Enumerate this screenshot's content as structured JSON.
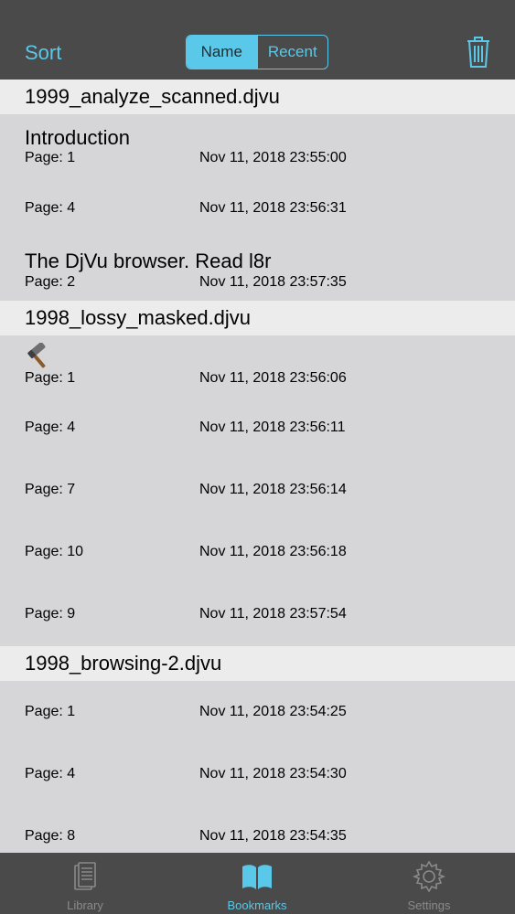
{
  "header": {
    "sort_label": "Sort",
    "segments": [
      {
        "label": "Name",
        "selected": true
      },
      {
        "label": "Recent",
        "selected": false
      }
    ],
    "trash_icon": "trash-icon"
  },
  "sections": [
    {
      "file": "1999_analyze_scanned.djvu",
      "items": [
        {
          "title": "Introduction",
          "page": "Page: 1",
          "date": "Nov 11, 2018 23:55:00"
        },
        {
          "title": "",
          "page": "Page: 4",
          "date": "Nov 11, 2018 23:56:31"
        },
        {
          "title": "The DjVu browser. Read l8r",
          "page": "Page: 2",
          "date": "Nov 11, 2018 23:57:35"
        }
      ]
    },
    {
      "file": "1998_lossy_masked.djvu",
      "items": [
        {
          "title_icon": "hammer-icon",
          "page": "Page: 1",
          "date": "Nov 11, 2018 23:56:06"
        },
        {
          "title": "",
          "page": "Page: 4",
          "date": "Nov 11, 2018 23:56:11"
        },
        {
          "title": "",
          "page": "Page: 7",
          "date": "Nov 11, 2018 23:56:14"
        },
        {
          "title": "",
          "page": "Page: 10",
          "date": "Nov 11, 2018 23:56:18"
        },
        {
          "title": "",
          "page": "Page: 9",
          "date": "Nov 11, 2018 23:57:54"
        }
      ]
    },
    {
      "file": "1998_browsing-2.djvu",
      "items": [
        {
          "title": "",
          "page": "Page: 1",
          "date": "Nov 11, 2018 23:54:25"
        },
        {
          "title": "",
          "page": "Page: 4",
          "date": "Nov 11, 2018 23:54:30"
        },
        {
          "title": "",
          "page": "Page: 8",
          "date": "Nov 11, 2018 23:54:35"
        }
      ]
    }
  ],
  "tabbar": {
    "tabs": [
      {
        "label": "Library",
        "icon": "library-icon",
        "active": false
      },
      {
        "label": "Bookmarks",
        "icon": "bookmarks-icon",
        "active": true
      },
      {
        "label": "Settings",
        "icon": "settings-icon",
        "active": false
      }
    ]
  },
  "colors": {
    "accent": "#5ac8e8",
    "bar": "#4a4a4a",
    "list_bg": "#d6d6d8",
    "section_bg": "#ececec"
  }
}
